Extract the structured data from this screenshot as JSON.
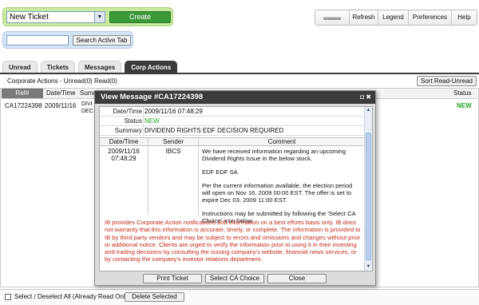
{
  "toolbar": {
    "ticket_select": "New Ticket",
    "create_label": "Create",
    "search_placeholder": "",
    "search_button": "Search Active Tab"
  },
  "topnav": {
    "refresh": "Refresh",
    "legend": "Legend",
    "preferences": "Preferences",
    "help": "Help"
  },
  "tabs": [
    {
      "label": "Unread"
    },
    {
      "label": "Tickets"
    },
    {
      "label": "Messages"
    },
    {
      "label": "Corp Actions"
    }
  ],
  "list": {
    "subheader": "Corporate Actions - Unread(0) Read(0)",
    "sort_button": "Sort Read-Unread",
    "columns": {
      "ref": "Ref#",
      "date": "Date/Time",
      "summary": "Sumr",
      "status": "Status"
    },
    "row": {
      "ref": "CA17224398",
      "date": "2009/11/16",
      "summary": "DIVI DEC",
      "status": "NEW"
    }
  },
  "bottom": {
    "select_all_label": "Select / Deselect All (Already Read Only)",
    "delete_button": "Delete Selected"
  },
  "modal": {
    "title": "View Message #CA17224398",
    "icons_text": "◘ ✖",
    "fields": {
      "datetime_label": "Date/Time",
      "datetime_value": "2009/11/16 07:48:29",
      "status_label": "Status",
      "status_value": "NEW",
      "summary_label": "Summary",
      "summary_value": "DIVIDEND RIGHTS EDF DECISION REQUIRED"
    },
    "comments_table": {
      "headers": {
        "date": "Date/Time",
        "sender": "Sender",
        "comment": "Comment"
      },
      "date_line1": "2009/11/16",
      "date_line2": "07:48:29",
      "sender": "IBCS",
      "comment_p1": "We have received information regarding an upcoming Dividend Rights Issue in the below stock.",
      "comment_p2": "EDF EDF SA",
      "comment_p3": "Per the current information available, the election period will open on Nov 16, 2009 00:00 EST. The offer is set to expire Dec 03, 2009 11:00 EST.",
      "comment_p4": "Instructions may be submitted by following the 'Select CA Choice' icon below."
    },
    "disclaimer": "IB provides Corporate Action notifications and information on a best efforts basis only. IB does not warranty that this information is accurate, timely, or complete. The information is provided to IB by third party vendors and may be subject to errors and omissions and changes without prior or additional notice. Clients are urged to verify the information prior to using it in their investing and trading decisions by consulting the issuing company's website, financial news services, or by contacting the company's investor relations department.",
    "buttons": {
      "print": "Print Ticket",
      "select_ca": "Select CA Choice",
      "close": "Close"
    }
  },
  "colors": {
    "accent_green": "#3a9a3a",
    "status_new": "#22a022",
    "disclaimer_red": "#c42b1c",
    "title_bar": "#3c3c3c"
  }
}
